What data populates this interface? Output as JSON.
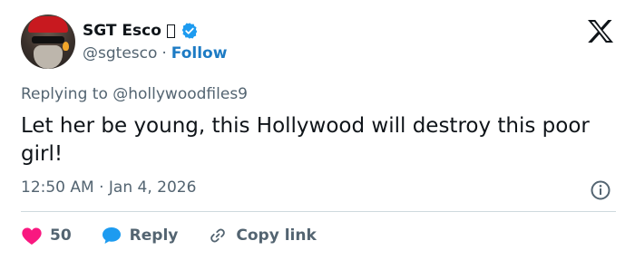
{
  "author": {
    "name": "SGT Esco",
    "name_suffix_glyph": "▯",
    "handle": "@sgtesco",
    "separator": "·",
    "follow_label": "Follow",
    "verified_color": "#1d9bf0"
  },
  "reply_context": {
    "prefix": "Replying to",
    "mention": "@hollywoodfiles9"
  },
  "tweet": {
    "text": "Let her be young, this Hollywood will destroy this poor girl!",
    "time": "12:50 AM",
    "separator": "·",
    "date": "Jan 4, 2026"
  },
  "actions": {
    "like_count": "50",
    "reply_label": "Reply",
    "copy_label": "Copy link"
  },
  "icons": [
    "x-logo-icon",
    "verified-badge-icon",
    "info-icon",
    "heart-icon",
    "reply-bubble-icon",
    "link-icon"
  ],
  "colors": {
    "heart": "#f91880",
    "reply_bubble": "#1d9bf0",
    "follow": "#1d7bc4",
    "muted": "#536471"
  }
}
